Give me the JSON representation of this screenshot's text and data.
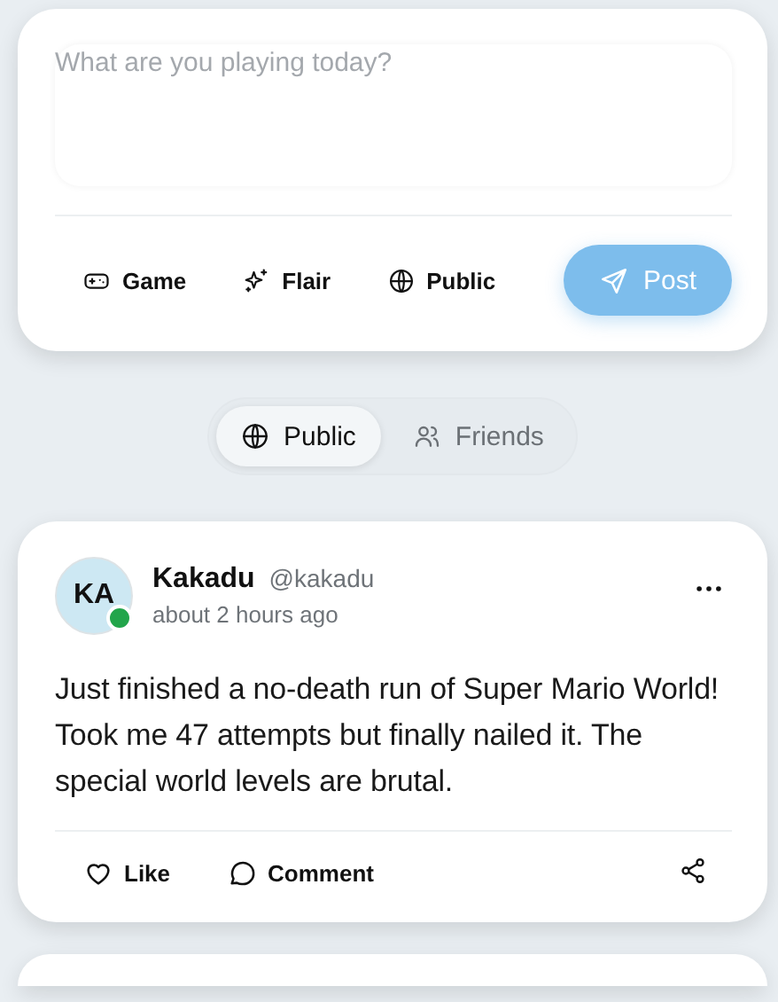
{
  "composer": {
    "placeholder": "What are you playing today?",
    "actions": [
      {
        "kind": "game",
        "label": "Game"
      },
      {
        "kind": "flair",
        "label": "Flair"
      },
      {
        "kind": "public",
        "label": "Public"
      }
    ],
    "post_button": "Post"
  },
  "feed_filter": [
    {
      "kind": "public",
      "label": "Public",
      "selected": true
    },
    {
      "kind": "friends",
      "label": "Friends",
      "selected": false
    }
  ],
  "posts": [
    {
      "avatar": "KA",
      "online": true,
      "name": "Kakadu",
      "handle": "@kakadu",
      "time": "about 2 hours ago",
      "text": "Just finished a no-death run of Super Mario World! Took me 47 attempts but finally nailed it. The special world levels are brutal.",
      "actions": [
        {
          "kind": "like",
          "label": "Like"
        },
        {
          "kind": "comment",
          "label": "Comment"
        }
      ]
    }
  ]
}
